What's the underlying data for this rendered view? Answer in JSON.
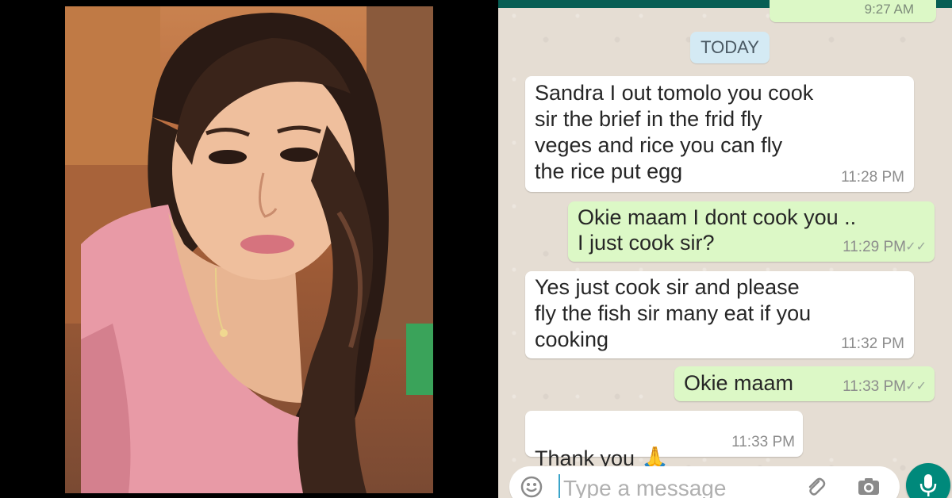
{
  "chat": {
    "prev_time": "9:27 AM",
    "day_label": "TODAY",
    "messages": [
      {
        "dir": "in",
        "text": "Sandra I out tomolo you cook\nsir the brief in the frid fly\nveges  and rice you can fly\nthe rice put egg",
        "time": "11:28 PM"
      },
      {
        "dir": "out",
        "text": "Okie maam I dont cook you ..\nI just cook sir?",
        "time": "11:29 PM"
      },
      {
        "dir": "in",
        "text": "Yes just cook sir and please\nfly the fish sir many eat if you\ncooking",
        "time": "11:32 PM"
      },
      {
        "dir": "out",
        "text": "Okie maam",
        "time": "11:33 PM"
      },
      {
        "dir": "in",
        "text": "Thank you",
        "time": "11:33 PM"
      }
    ],
    "input_placeholder": "Type a message"
  },
  "icons": {
    "emoji": "smiley-icon",
    "attach": "paperclip-icon",
    "camera": "camera-icon",
    "mic": "mic-icon",
    "read_receipt": "double-check-icon",
    "prayer_emoji": "folded-hands-emoji"
  },
  "colors": {
    "incoming_bubble": "#ffffff",
    "outgoing_bubble": "#dcf8c6",
    "chat_background": "#e5ddd3",
    "header": "#075e54",
    "mic_button": "#00897b",
    "day_chip": "#d4eaf4"
  }
}
